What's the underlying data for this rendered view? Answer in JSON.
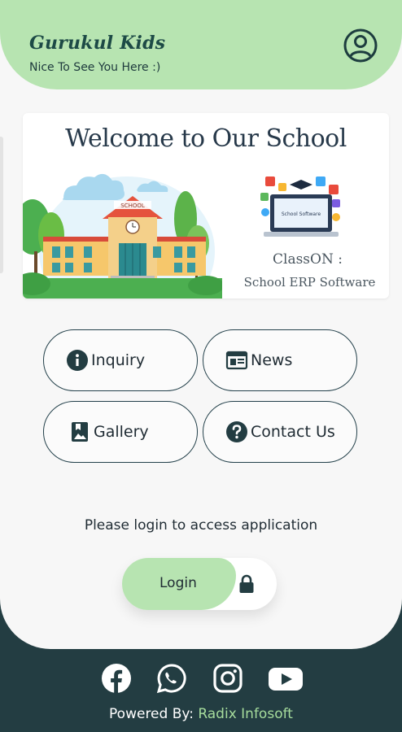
{
  "header": {
    "title": "Gurukul Kids",
    "subtitle": "Nice To See You Here :)"
  },
  "banner": {
    "title": "Welcome to Our School",
    "building_sign": "SCHOOL",
    "laptop_text": "School Software",
    "product_name": "ClassON :",
    "product_tagline": "School ERP Software"
  },
  "menu": {
    "inquiry": "Inquiry",
    "news": "News",
    "gallery": "Gallery",
    "contact": "Contact Us"
  },
  "auth": {
    "prompt": "Please login to access application",
    "login_label": "Login"
  },
  "footer": {
    "powered_prefix": "Powered By: ",
    "powered_company": "Radix Infosoft"
  },
  "icons": {
    "profile": "account-circle-icon",
    "inquiry": "info-icon",
    "news": "newspaper-icon",
    "gallery": "photo-bookmark-icon",
    "contact": "help-icon",
    "lock": "lock-icon",
    "facebook": "facebook-icon",
    "whatsapp": "whatsapp-icon",
    "instagram": "instagram-icon",
    "youtube": "youtube-icon"
  },
  "colors": {
    "accent": "#b7e4b1",
    "dark": "#233d42",
    "text": "#1f2b33",
    "highlight": "#a6dc9c"
  }
}
